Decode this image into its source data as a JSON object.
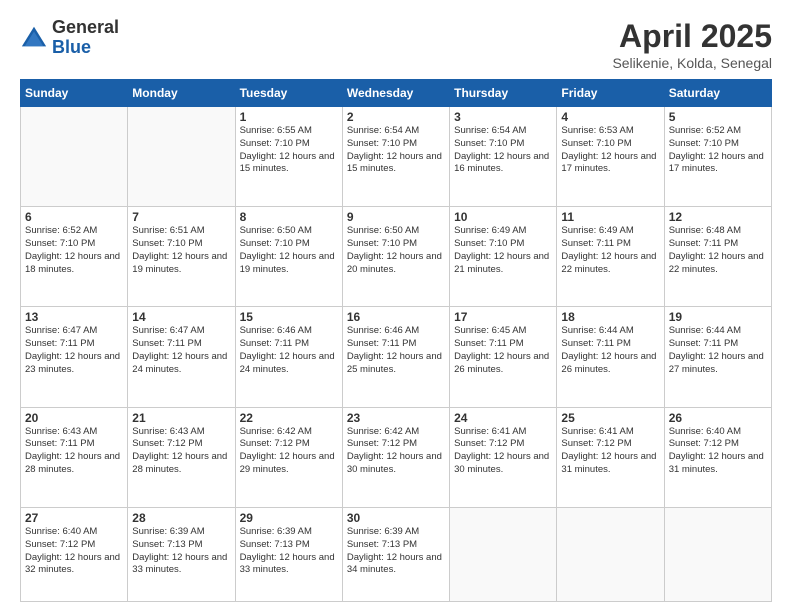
{
  "logo": {
    "general": "General",
    "blue": "Blue"
  },
  "title": {
    "month": "April 2025",
    "location": "Selikenie, Kolda, Senegal"
  },
  "weekdays": [
    "Sunday",
    "Monday",
    "Tuesday",
    "Wednesday",
    "Thursday",
    "Friday",
    "Saturday"
  ],
  "weeks": [
    [
      {
        "day": "",
        "info": ""
      },
      {
        "day": "",
        "info": ""
      },
      {
        "day": "1",
        "info": "Sunrise: 6:55 AM\nSunset: 7:10 PM\nDaylight: 12 hours and 15 minutes."
      },
      {
        "day": "2",
        "info": "Sunrise: 6:54 AM\nSunset: 7:10 PM\nDaylight: 12 hours and 15 minutes."
      },
      {
        "day": "3",
        "info": "Sunrise: 6:54 AM\nSunset: 7:10 PM\nDaylight: 12 hours and 16 minutes."
      },
      {
        "day": "4",
        "info": "Sunrise: 6:53 AM\nSunset: 7:10 PM\nDaylight: 12 hours and 17 minutes."
      },
      {
        "day": "5",
        "info": "Sunrise: 6:52 AM\nSunset: 7:10 PM\nDaylight: 12 hours and 17 minutes."
      }
    ],
    [
      {
        "day": "6",
        "info": "Sunrise: 6:52 AM\nSunset: 7:10 PM\nDaylight: 12 hours and 18 minutes."
      },
      {
        "day": "7",
        "info": "Sunrise: 6:51 AM\nSunset: 7:10 PM\nDaylight: 12 hours and 19 minutes."
      },
      {
        "day": "8",
        "info": "Sunrise: 6:50 AM\nSunset: 7:10 PM\nDaylight: 12 hours and 19 minutes."
      },
      {
        "day": "9",
        "info": "Sunrise: 6:50 AM\nSunset: 7:10 PM\nDaylight: 12 hours and 20 minutes."
      },
      {
        "day": "10",
        "info": "Sunrise: 6:49 AM\nSunset: 7:10 PM\nDaylight: 12 hours and 21 minutes."
      },
      {
        "day": "11",
        "info": "Sunrise: 6:49 AM\nSunset: 7:11 PM\nDaylight: 12 hours and 22 minutes."
      },
      {
        "day": "12",
        "info": "Sunrise: 6:48 AM\nSunset: 7:11 PM\nDaylight: 12 hours and 22 minutes."
      }
    ],
    [
      {
        "day": "13",
        "info": "Sunrise: 6:47 AM\nSunset: 7:11 PM\nDaylight: 12 hours and 23 minutes."
      },
      {
        "day": "14",
        "info": "Sunrise: 6:47 AM\nSunset: 7:11 PM\nDaylight: 12 hours and 24 minutes."
      },
      {
        "day": "15",
        "info": "Sunrise: 6:46 AM\nSunset: 7:11 PM\nDaylight: 12 hours and 24 minutes."
      },
      {
        "day": "16",
        "info": "Sunrise: 6:46 AM\nSunset: 7:11 PM\nDaylight: 12 hours and 25 minutes."
      },
      {
        "day": "17",
        "info": "Sunrise: 6:45 AM\nSunset: 7:11 PM\nDaylight: 12 hours and 26 minutes."
      },
      {
        "day": "18",
        "info": "Sunrise: 6:44 AM\nSunset: 7:11 PM\nDaylight: 12 hours and 26 minutes."
      },
      {
        "day": "19",
        "info": "Sunrise: 6:44 AM\nSunset: 7:11 PM\nDaylight: 12 hours and 27 minutes."
      }
    ],
    [
      {
        "day": "20",
        "info": "Sunrise: 6:43 AM\nSunset: 7:11 PM\nDaylight: 12 hours and 28 minutes."
      },
      {
        "day": "21",
        "info": "Sunrise: 6:43 AM\nSunset: 7:12 PM\nDaylight: 12 hours and 28 minutes."
      },
      {
        "day": "22",
        "info": "Sunrise: 6:42 AM\nSunset: 7:12 PM\nDaylight: 12 hours and 29 minutes."
      },
      {
        "day": "23",
        "info": "Sunrise: 6:42 AM\nSunset: 7:12 PM\nDaylight: 12 hours and 30 minutes."
      },
      {
        "day": "24",
        "info": "Sunrise: 6:41 AM\nSunset: 7:12 PM\nDaylight: 12 hours and 30 minutes."
      },
      {
        "day": "25",
        "info": "Sunrise: 6:41 AM\nSunset: 7:12 PM\nDaylight: 12 hours and 31 minutes."
      },
      {
        "day": "26",
        "info": "Sunrise: 6:40 AM\nSunset: 7:12 PM\nDaylight: 12 hours and 31 minutes."
      }
    ],
    [
      {
        "day": "27",
        "info": "Sunrise: 6:40 AM\nSunset: 7:12 PM\nDaylight: 12 hours and 32 minutes."
      },
      {
        "day": "28",
        "info": "Sunrise: 6:39 AM\nSunset: 7:13 PM\nDaylight: 12 hours and 33 minutes."
      },
      {
        "day": "29",
        "info": "Sunrise: 6:39 AM\nSunset: 7:13 PM\nDaylight: 12 hours and 33 minutes."
      },
      {
        "day": "30",
        "info": "Sunrise: 6:39 AM\nSunset: 7:13 PM\nDaylight: 12 hours and 34 minutes."
      },
      {
        "day": "",
        "info": ""
      },
      {
        "day": "",
        "info": ""
      },
      {
        "day": "",
        "info": ""
      }
    ]
  ]
}
